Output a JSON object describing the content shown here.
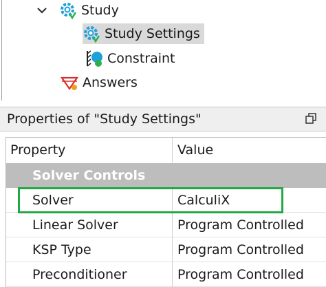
{
  "tree": {
    "items": [
      {
        "label": "Study"
      },
      {
        "label": "Study Settings"
      },
      {
        "label": "Constraint"
      },
      {
        "label": "Answers"
      }
    ]
  },
  "panel": {
    "title": "Properties of \"Study Settings\""
  },
  "grid": {
    "headers": [
      "Property",
      "Value"
    ],
    "group": "Solver Controls",
    "rows": [
      {
        "property": "Solver",
        "value": "CalculiX"
      },
      {
        "property": "Linear Solver",
        "value": "Program Controlled"
      },
      {
        "property": "KSP Type",
        "value": "Program Controlled"
      },
      {
        "property": "Preconditioner",
        "value": "Program Controlled"
      }
    ]
  },
  "colors": {
    "highlight": "#22a844",
    "group_bg": "#bdbdbd",
    "selected_bg": "#d9d9d9"
  }
}
